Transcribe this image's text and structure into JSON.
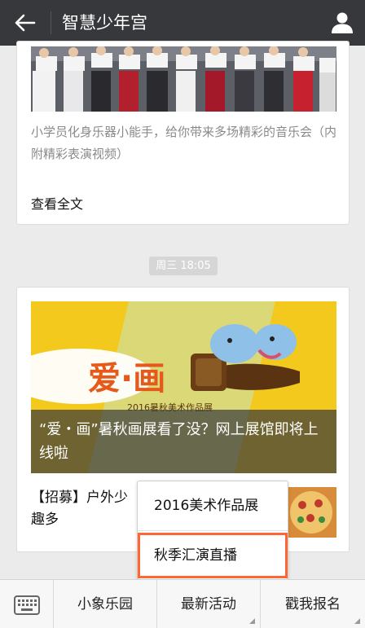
{
  "header": {
    "title": "智慧少年宫"
  },
  "article1": {
    "description": "小学员化身乐器小能手，给你带来多场精彩的音乐会（内附精彩表演视频）",
    "read_more": "查看全文"
  },
  "timestamp": "周三 18:05",
  "article2": {
    "banner_caption": "“爱・画”暑秋画展看了没？网上展馆即将上线啦",
    "banner_art_title": "爱·画",
    "banner_art_subtitle": "2016暑秋美术作品展",
    "sub_title": "【招募】户外少 趣多"
  },
  "popup_menu": {
    "items": [
      "2016美术作品展",
      "秋季汇演直播"
    ]
  },
  "bottom_menu": {
    "items": [
      "小象乐园",
      "最新活动",
      "戳我报名"
    ]
  },
  "colors": {
    "header_bg": "#36383b",
    "page_bg": "#ebebeb",
    "highlight_border": "#ff6633",
    "banner_yellow": "#f2c91c"
  },
  "icons": {
    "back": "back-arrow-icon",
    "profile": "profile-icon",
    "keyboard": "keyboard-icon"
  }
}
